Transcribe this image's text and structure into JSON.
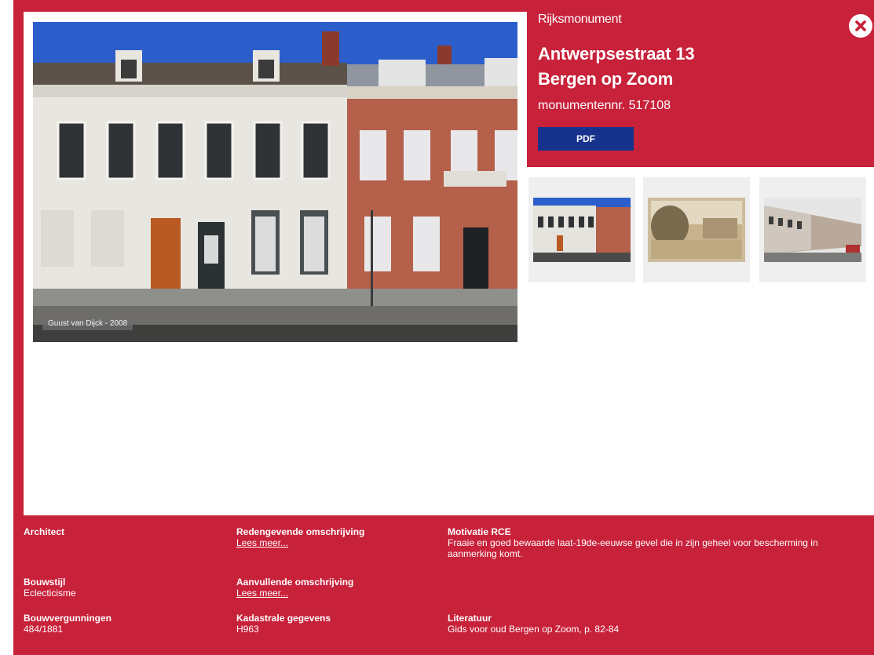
{
  "monument": {
    "category": "Rijksmonument",
    "title_line1": "Antwerpsestraat 13",
    "title_line2": "Bergen op Zoom",
    "number": "monumentennr. 517108",
    "pdf_label": "PDF"
  },
  "photo": {
    "credit": "Guust van Dijck - 2008"
  },
  "thumbnails": [
    {
      "name": "thumb-street-facade"
    },
    {
      "name": "thumb-historic-sepia"
    },
    {
      "name": "thumb-street-perspective"
    }
  ],
  "details": {
    "architect": {
      "label": "Architect"
    },
    "bouwstijl": {
      "label": "Bouwstijl",
      "value": "Eclecticisme"
    },
    "bouwvergunningen": {
      "label": "Bouwvergunningen",
      "value": "484/1881"
    },
    "redengevende": {
      "label": "Redengevende omschrijving",
      "link": "Lees meer..."
    },
    "aanvullende": {
      "label": "Aanvullende omschrijving",
      "link": "Lees meer..."
    },
    "kadastrale": {
      "label": "Kadastrale gegevens",
      "value": "H963"
    },
    "motivatie": {
      "label": "Motivatie RCE",
      "value": "Fraaie en goed bewaarde laat-19de-eeuwse gevel die in zijn geheel voor bescherming in aanmerking komt."
    },
    "literatuur": {
      "label": "Literatuur",
      "value": "Gids voor oud Bergen op Zoom, p. 82-84"
    }
  },
  "colors": {
    "accent_red": "#c8213a",
    "pdf_blue": "#17328c"
  }
}
